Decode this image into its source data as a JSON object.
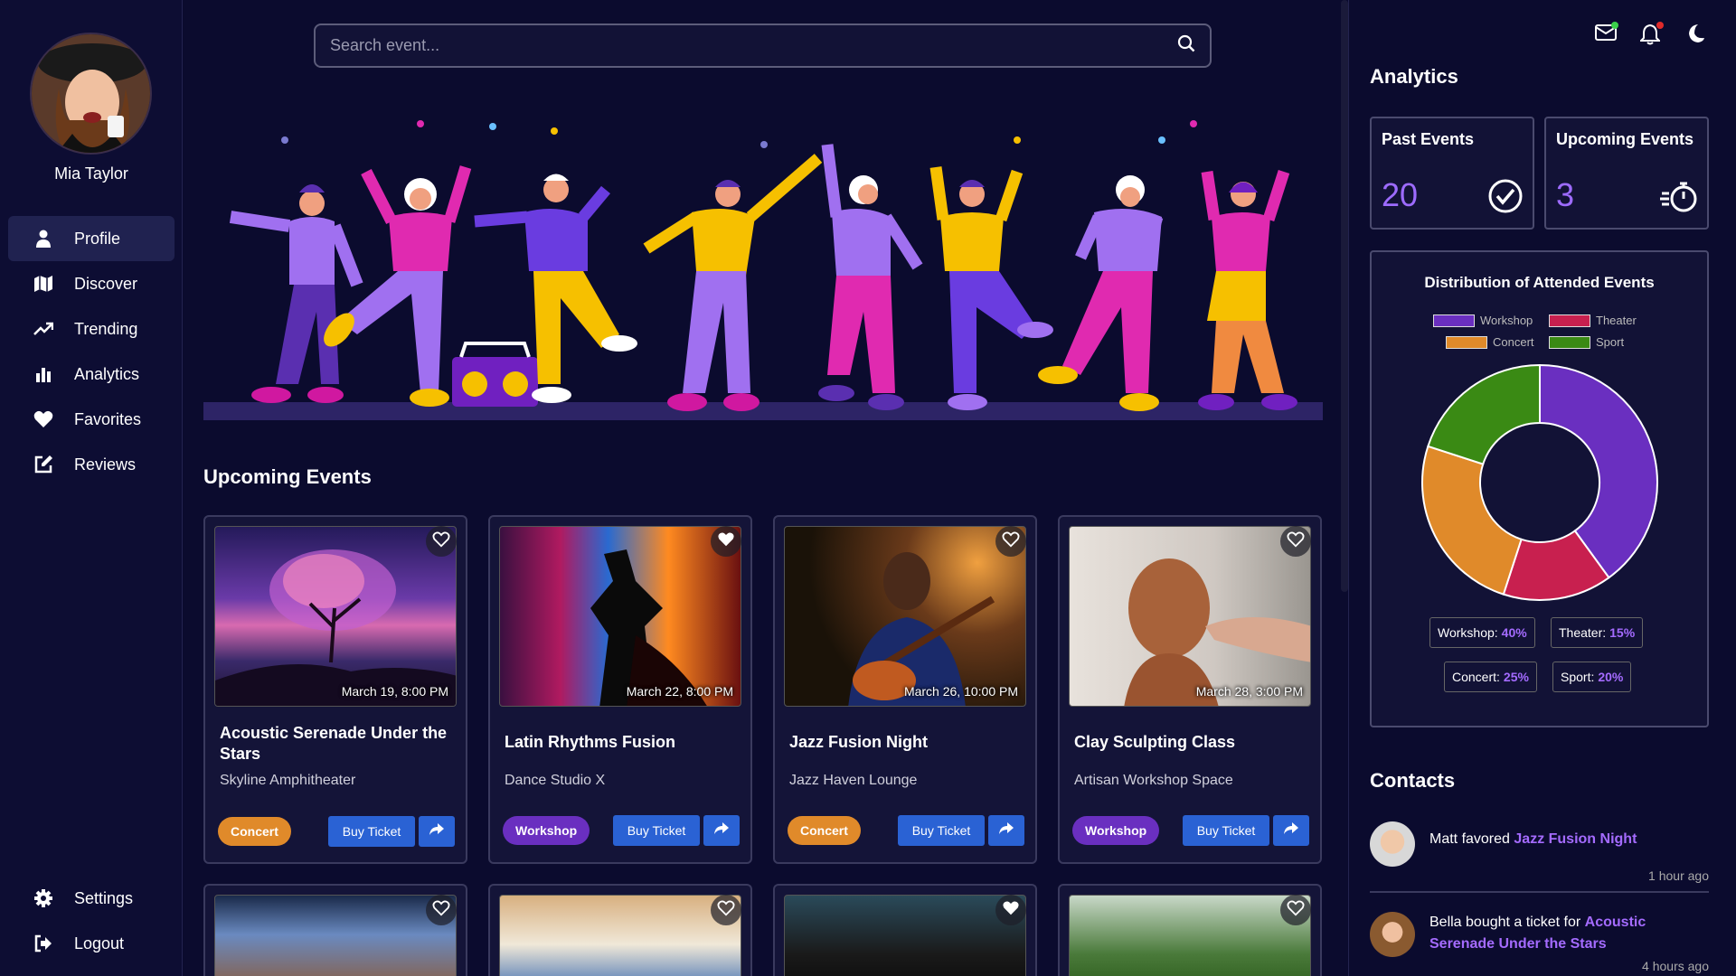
{
  "user": {
    "name": "Mia Taylor"
  },
  "nav": {
    "items": [
      {
        "label": "Profile",
        "icon": "user-icon",
        "active": true
      },
      {
        "label": "Discover",
        "icon": "map-icon"
      },
      {
        "label": "Trending",
        "icon": "trending-icon"
      },
      {
        "label": "Analytics",
        "icon": "chart-icon"
      },
      {
        "label": "Favorites",
        "icon": "heart-icon"
      },
      {
        "label": "Reviews",
        "icon": "edit-icon"
      }
    ],
    "bottom": [
      {
        "label": "Settings",
        "icon": "gear-icon"
      },
      {
        "label": "Logout",
        "icon": "logout-icon"
      }
    ]
  },
  "search": {
    "placeholder": "Search event..."
  },
  "upcoming": {
    "title": "Upcoming Events",
    "events": [
      {
        "title": "Acoustic Serenade Under the Stars",
        "venue": "Skyline Amphitheater",
        "date": "March 19, 8:00 PM",
        "category": "Concert",
        "favorited": false
      },
      {
        "title": "Latin Rhythms Fusion",
        "venue": "Dance Studio X",
        "date": "March 22, 8:00 PM",
        "category": "Workshop",
        "favorited": true
      },
      {
        "title": "Jazz Fusion Night",
        "venue": "Jazz Haven Lounge",
        "date": "March 26, 10:00 PM",
        "category": "Concert",
        "favorited": false
      },
      {
        "title": "Clay Sculpting Class",
        "venue": "Artisan Workshop Space",
        "date": "March 28, 3:00 PM",
        "category": "Workshop",
        "favorited": false
      }
    ],
    "buy_label": "Buy Ticket"
  },
  "analytics": {
    "title": "Analytics",
    "past": {
      "label": "Past Events",
      "value": "20"
    },
    "upcoming": {
      "label": "Upcoming Events",
      "value": "3"
    }
  },
  "chart_data": {
    "type": "pie",
    "title": "Distribution of Attended Events",
    "categories": [
      "Workshop",
      "Theater",
      "Concert",
      "Sport"
    ],
    "values": [
      40,
      15,
      25,
      20
    ],
    "value_labels": [
      "40%",
      "15%",
      "25%",
      "20%"
    ],
    "colors": [
      "#6a2fc0",
      "#c8204f",
      "#e08a2a",
      "#3a8a14"
    ],
    "legend": "top",
    "donut": true
  },
  "contacts": {
    "title": "Contacts",
    "items": [
      {
        "text": "Matt favored",
        "event": "Jazz Fusion Night",
        "time": "1 hour ago"
      },
      {
        "text": "Bella bought a ticket for",
        "event": "Acoustic Serenade Under the Stars",
        "time": "4 hours ago"
      }
    ]
  },
  "colors": {
    "accent": "#9d6bff",
    "button": "#2a62d4",
    "background": "#0b0b2e"
  }
}
